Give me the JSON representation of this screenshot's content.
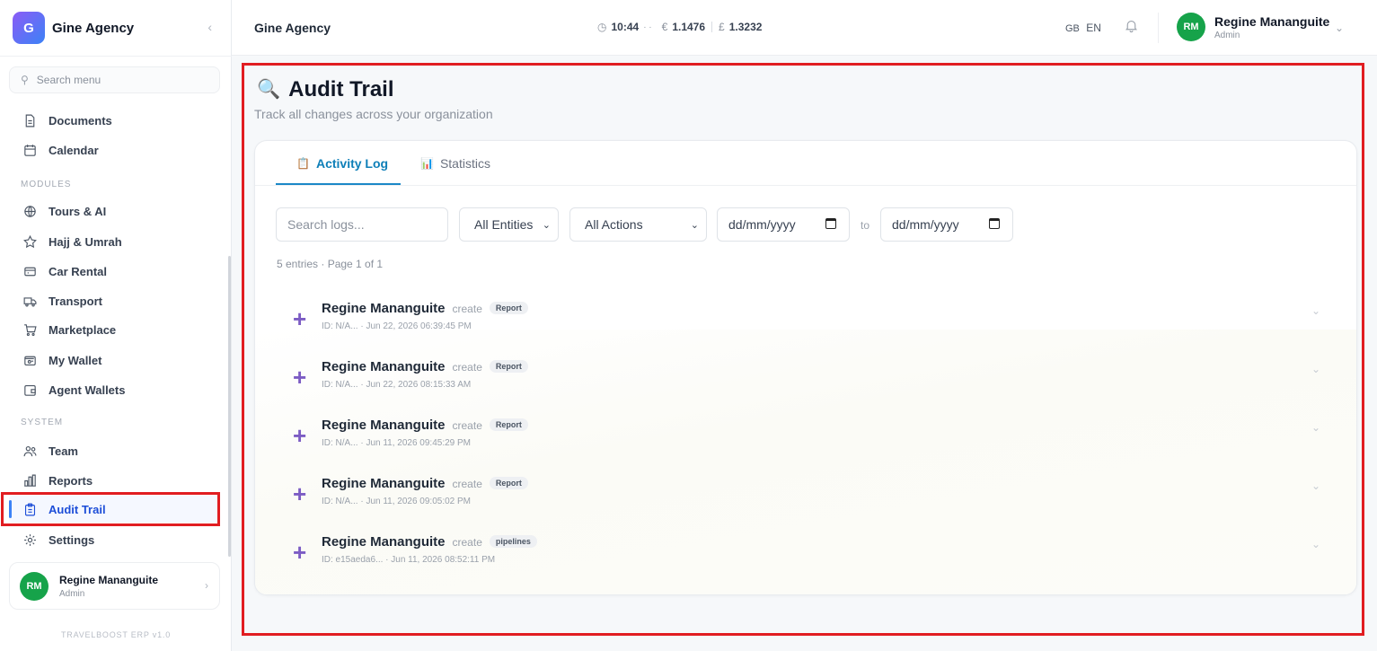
{
  "brand": {
    "logo_letter": "G",
    "name": "Gine Agency"
  },
  "sidebar": {
    "search_placeholder": "Search menu",
    "items_top": [
      {
        "label": "Documents",
        "icon": "document-icon"
      },
      {
        "label": "Calendar",
        "icon": "calendar-icon"
      }
    ],
    "modules_label": "MODULES",
    "modules": [
      {
        "label": "Tours & AI",
        "icon": "globe-icon"
      },
      {
        "label": "Hajj & Umrah",
        "icon": "star-icon"
      },
      {
        "label": "Car Rental",
        "icon": "car-icon"
      },
      {
        "label": "Transport",
        "icon": "truck-icon"
      },
      {
        "label": "Marketplace",
        "icon": "cart-icon"
      },
      {
        "label": "My Wallet",
        "icon": "wallet-icon"
      },
      {
        "label": "Agent Wallets",
        "icon": "wallet-icon"
      }
    ],
    "system_label": "SYSTEM",
    "system": [
      {
        "label": "Team",
        "icon": "users-icon"
      },
      {
        "label": "Reports",
        "icon": "bar-chart-icon"
      },
      {
        "label": "Audit Trail",
        "icon": "clipboard-icon",
        "active": true
      },
      {
        "label": "Settings",
        "icon": "gear-icon"
      }
    ],
    "user": {
      "initials": "RM",
      "name": "Regine Mananguite",
      "role": "Admin"
    },
    "version": "TRAVELBOOST ERP v1.0"
  },
  "topbar": {
    "title": "Gine Agency",
    "time": "10:44",
    "dots": "· ·",
    "eur_symbol": "€",
    "eur_rate": "1.1476",
    "gbp_symbol": "£",
    "gbp_rate": "1.3232",
    "lang_flag": "GB",
    "lang": "EN",
    "user": {
      "initials": "RM",
      "name": "Regine Mananguite",
      "role": "Admin"
    }
  },
  "page": {
    "title_icon": "🔍",
    "title": "Audit Trail",
    "subtitle": "Track all changes across your organization",
    "tabs": [
      {
        "icon": "📋",
        "label": "Activity Log",
        "active": true
      },
      {
        "icon": "📊",
        "label": "Statistics",
        "active": false
      }
    ],
    "filters": {
      "search_placeholder": "Search logs...",
      "entity_select": "All Entities",
      "action_select": "All Actions",
      "date_from": "dd/mm/yyyy",
      "to_label": "to",
      "date_to": "dd/mm/yyyy"
    },
    "entries_summary": "5 entries · Page 1 of 1",
    "logs": [
      {
        "user": "Regine Mananguite",
        "action": "create",
        "entity": "Report",
        "meta": "ID: N/A... · Jun 22, 2026 06:39:45 PM"
      },
      {
        "user": "Regine Mananguite",
        "action": "create",
        "entity": "Report",
        "meta": "ID: N/A... · Jun 22, 2026 08:15:33 AM"
      },
      {
        "user": "Regine Mananguite",
        "action": "create",
        "entity": "Report",
        "meta": "ID: N/A... · Jun 11, 2026 09:45:29 PM"
      },
      {
        "user": "Regine Mananguite",
        "action": "create",
        "entity": "Report",
        "meta": "ID: N/A... · Jun 11, 2026 09:05:02 PM"
      },
      {
        "user": "Regine Mananguite",
        "action": "create",
        "entity": "pipelines",
        "meta": "ID: e15aeda6... · Jun 11, 2026 08:52:11 PM"
      }
    ]
  }
}
